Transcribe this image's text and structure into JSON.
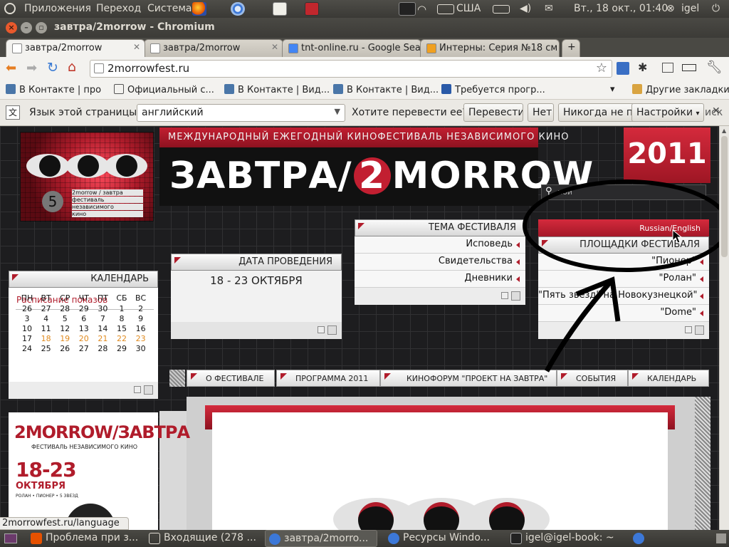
{
  "panel": {
    "apps": "Приложения",
    "places": "Переход",
    "system": "Система",
    "keyboard": "США",
    "clock": "Вт., 18 окт., 01:40",
    "user": "igel"
  },
  "window": {
    "title": "завтра/2morrow - Chromium"
  },
  "tabs": [
    {
      "label": "завтра/2morrow"
    },
    {
      "label": "завтра/2morrow"
    },
    {
      "label": "tnt-online.ru - Google Sea"
    },
    {
      "label": "Интерны: Серия №18 см"
    }
  ],
  "omnibox": {
    "url": "2morrowfest.ru"
  },
  "bookmarks": {
    "items": [
      "В Контакте | про",
      "Официальный с...",
      "В Контакте | Вид...",
      "В Контакте | Вид...",
      "Требуется прогр..."
    ],
    "other": "Другие закладки"
  },
  "translate": {
    "label": "Язык этой страницы",
    "language": "английский",
    "question": "Хотите перевести ее?",
    "translate_btn": "Перевести",
    "no_btn": "Нет",
    "never_btn": "Никогда не пе",
    "settings_btn": "Настройки"
  },
  "site": {
    "tagline": "МЕЖДУНАРОДНЫЙ ЕЖЕГОДНЫЙ КИНОФЕСТИВАЛЬ НЕЗАВИСИМОГО КИНО",
    "logo_a": "ЗАВТРА/",
    "logo_num": "2",
    "logo_b": "MORROW",
    "year": "2011",
    "search_placeholder": "пои",
    "mini_logo": {
      "num": "5",
      "lines": [
        "2morrow / завтра",
        "фестиваль",
        "независимого",
        "кино"
      ]
    },
    "theme": {
      "title": "ТЕМА ФЕСТИВАЛЯ",
      "items": [
        "Исповедь",
        "Свидетельства",
        "Дневники"
      ]
    },
    "lang": "Russian/English",
    "venues": {
      "title": "ПЛОЩАДКИ ФЕСТИВАЛЯ",
      "items": [
        "\"Пионер\"",
        "\"Ролан\"",
        "\"Пять звезд\" на Новокузнецкой\"",
        "\"Dome\""
      ]
    },
    "dates": {
      "title": "ДАТА ПРОВЕДЕНИЯ",
      "value": "18 - 23 ОКТЯБРЯ"
    },
    "calendar": {
      "title": "КАЛЕНДАРЬ",
      "subtitle": "Расписание показов",
      "weekdays": [
        "ПН",
        "ВТ",
        "СР",
        "ЧТ",
        "ПТ",
        "СБ",
        "ВС"
      ],
      "weeks": [
        [
          "26",
          "27",
          "28",
          "29",
          "30",
          "1",
          "2"
        ],
        [
          "3",
          "4",
          "5",
          "6",
          "7",
          "8",
          "9"
        ],
        [
          "10",
          "11",
          "12",
          "13",
          "14",
          "15",
          "16"
        ],
        [
          "17",
          "18",
          "19",
          "20",
          "21",
          "22",
          "23"
        ],
        [
          "24",
          "25",
          "26",
          "27",
          "28",
          "29",
          "30"
        ]
      ],
      "highlight_color": "#e08a1e"
    },
    "nav": [
      "О ФЕСТИВАЛЕ",
      "ПРОГРАММА 2011",
      "КИНОФОРУМ \"ПРОЕКТ НА ЗАВТРА\"",
      "СОБЫТИЯ",
      "КАЛЕНДАРЬ"
    ],
    "poster": {
      "title": "2MORROW/ЗАВТРА",
      "subtitle": "ФЕСТИВАЛЬ НЕЗАВИСИМОГО КИНО",
      "dates": "18-23",
      "month": "ОКТЯБРЯ",
      "venues": "РОЛАН • ПИОНЕР • 5 ЗВЕЗД"
    }
  },
  "status": {
    "url": "2morrowfest.ru/language"
  },
  "taskbar": {
    "items": [
      "Проблема при з...",
      "Входящие (278 ...",
      "завтра/2morro...",
      "Ресурсы Windo...",
      "igel@igel-book: ~"
    ]
  },
  "colors": {
    "brand_red": "#b01c2b",
    "accent_orange": "#dd4814",
    "page_dark": "#1d1d1f"
  }
}
